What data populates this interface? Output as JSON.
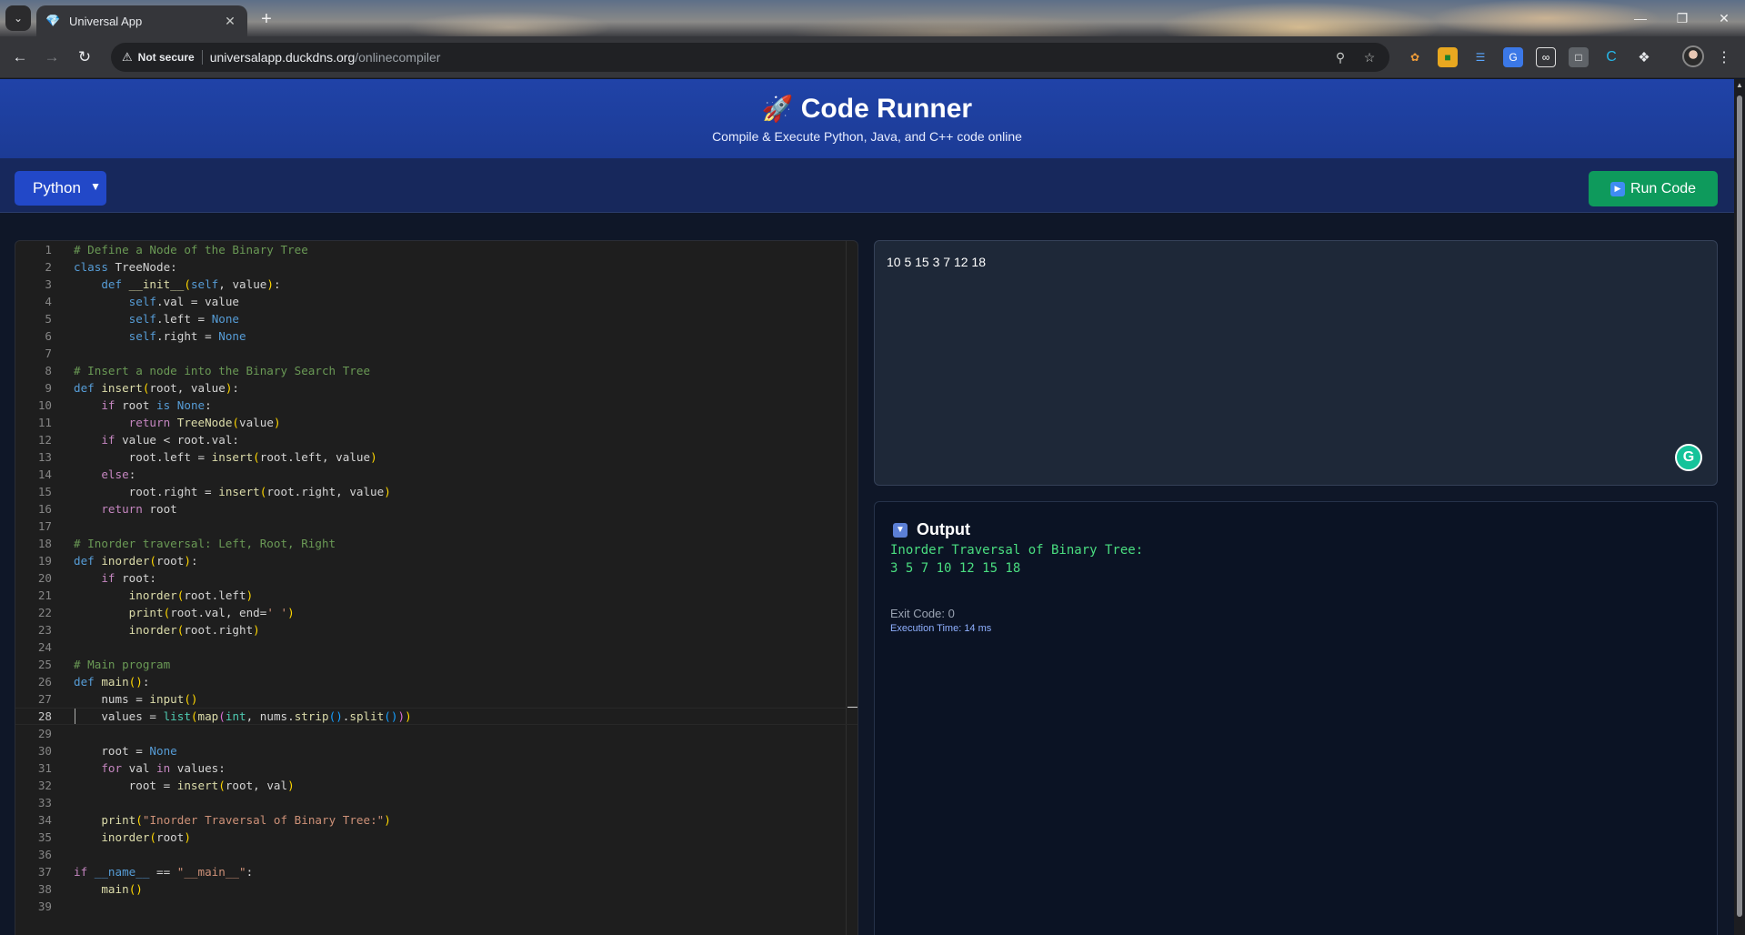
{
  "browser": {
    "tab_title": "Universal App",
    "security_label": "Not secure",
    "url_host": "universalapp.duckdns.org",
    "url_path": "/onlinecompiler"
  },
  "header": {
    "title": "Code Runner",
    "subtitle": "Compile & Execute Python, Java, and C++ code online"
  },
  "controls": {
    "language": "Python",
    "run_label": "Run Code"
  },
  "editor": {
    "active_line": 28,
    "lines": [
      [
        [
          "c-cm",
          "# Define a Node of the Binary Tree"
        ]
      ],
      [
        [
          "c-kw",
          "class"
        ],
        [
          "",
          " TreeNode:"
        ]
      ],
      [
        [
          "",
          "    "
        ],
        [
          "c-kw",
          "def"
        ],
        [
          "c-fn",
          " __init__"
        ],
        [
          "c-p1",
          "("
        ],
        [
          "c-kw",
          "self"
        ],
        [
          "",
          ", value"
        ],
        [
          "c-p1",
          ")"
        ],
        [
          "",
          ":"
        ]
      ],
      [
        [
          "",
          "        "
        ],
        [
          "c-kw",
          "self"
        ],
        [
          "",
          ".val = value"
        ]
      ],
      [
        [
          "",
          "        "
        ],
        [
          "c-kw",
          "self"
        ],
        [
          "",
          ".left = "
        ],
        [
          "c-kw",
          "None"
        ]
      ],
      [
        [
          "",
          "        "
        ],
        [
          "c-kw",
          "self"
        ],
        [
          "",
          ".right = "
        ],
        [
          "c-kw",
          "None"
        ]
      ],
      [],
      [
        [
          "c-cm",
          "# Insert a node into the Binary Search Tree"
        ]
      ],
      [
        [
          "c-kw",
          "def"
        ],
        [
          "c-fn",
          " insert"
        ],
        [
          "c-p1",
          "("
        ],
        [
          "",
          "root, value"
        ],
        [
          "c-p1",
          ")"
        ],
        [
          "",
          ":"
        ]
      ],
      [
        [
          "",
          "    "
        ],
        [
          "c-kc",
          "if"
        ],
        [
          "",
          " root "
        ],
        [
          "c-kw",
          "is"
        ],
        [
          "",
          " "
        ],
        [
          "c-kw",
          "None"
        ],
        [
          "",
          ":"
        ]
      ],
      [
        [
          "",
          "        "
        ],
        [
          "c-kc",
          "return"
        ],
        [
          "c-fn",
          " TreeNode"
        ],
        [
          "c-p1",
          "("
        ],
        [
          "",
          "value"
        ],
        [
          "c-p1",
          ")"
        ]
      ],
      [
        [
          "",
          "    "
        ],
        [
          "c-kc",
          "if"
        ],
        [
          "",
          " value < root.val:"
        ]
      ],
      [
        [
          "",
          "        root.left = "
        ],
        [
          "c-fn",
          "insert"
        ],
        [
          "c-p1",
          "("
        ],
        [
          "",
          "root.left, value"
        ],
        [
          "c-p1",
          ")"
        ]
      ],
      [
        [
          "",
          "    "
        ],
        [
          "c-kc",
          "else"
        ],
        [
          "",
          ":"
        ]
      ],
      [
        [
          "",
          "        root.right = "
        ],
        [
          "c-fn",
          "insert"
        ],
        [
          "c-p1",
          "("
        ],
        [
          "",
          "root.right, value"
        ],
        [
          "c-p1",
          ")"
        ]
      ],
      [
        [
          "",
          "    "
        ],
        [
          "c-kc",
          "return"
        ],
        [
          "",
          " root"
        ]
      ],
      [],
      [
        [
          "c-cm",
          "# Inorder traversal: Left, Root, Right"
        ]
      ],
      [
        [
          "c-kw",
          "def"
        ],
        [
          "c-fn",
          " inorder"
        ],
        [
          "c-p1",
          "("
        ],
        [
          "",
          "root"
        ],
        [
          "c-p1",
          ")"
        ],
        [
          "",
          ":"
        ]
      ],
      [
        [
          "",
          "    "
        ],
        [
          "c-kc",
          "if"
        ],
        [
          "",
          " root:"
        ]
      ],
      [
        [
          "",
          "        "
        ],
        [
          "c-fn",
          "inorder"
        ],
        [
          "c-p1",
          "("
        ],
        [
          "",
          "root.left"
        ],
        [
          "c-p1",
          ")"
        ]
      ],
      [
        [
          "",
          "        "
        ],
        [
          "c-fn",
          "print"
        ],
        [
          "c-p1",
          "("
        ],
        [
          "",
          "root.val, end="
        ],
        [
          "c-st",
          "' '"
        ],
        [
          "c-p1",
          ")"
        ]
      ],
      [
        [
          "",
          "        "
        ],
        [
          "c-fn",
          "inorder"
        ],
        [
          "c-p1",
          "("
        ],
        [
          "",
          "root.right"
        ],
        [
          "c-p1",
          ")"
        ]
      ],
      [],
      [
        [
          "c-cm",
          "# Main program"
        ]
      ],
      [
        [
          "c-kw",
          "def"
        ],
        [
          "c-fn",
          " main"
        ],
        [
          "c-p1",
          "()"
        ],
        [
          "",
          ":"
        ]
      ],
      [
        [
          "",
          "    nums = "
        ],
        [
          "c-fn",
          "input"
        ],
        [
          "c-p1",
          "()"
        ]
      ],
      [
        [
          "",
          "    values = "
        ],
        [
          "c-bi",
          "list"
        ],
        [
          "c-p1",
          "("
        ],
        [
          "c-fn",
          "map"
        ],
        [
          "c-p2",
          "("
        ],
        [
          "c-bi",
          "int"
        ],
        [
          "",
          ", nums."
        ],
        [
          "c-fn",
          "strip"
        ],
        [
          "c-p3",
          "()"
        ],
        [
          "",
          "."
        ],
        [
          "c-fn",
          "split"
        ],
        [
          "c-p3",
          "()"
        ],
        [
          "c-p2",
          ")"
        ],
        [
          "c-p1",
          ")"
        ]
      ],
      [],
      [
        [
          "",
          "    root = "
        ],
        [
          "c-kw",
          "None"
        ]
      ],
      [
        [
          "",
          "    "
        ],
        [
          "c-kc",
          "for"
        ],
        [
          "",
          " val "
        ],
        [
          "c-kc",
          "in"
        ],
        [
          "",
          " values:"
        ]
      ],
      [
        [
          "",
          "        root = "
        ],
        [
          "c-fn",
          "insert"
        ],
        [
          "c-p1",
          "("
        ],
        [
          "",
          "root, val"
        ],
        [
          "c-p1",
          ")"
        ]
      ],
      [],
      [
        [
          "",
          "    "
        ],
        [
          "c-fn",
          "print"
        ],
        [
          "c-p1",
          "("
        ],
        [
          "c-st",
          "\"Inorder Traversal of Binary Tree:\""
        ],
        [
          "c-p1",
          ")"
        ]
      ],
      [
        [
          "",
          "    "
        ],
        [
          "c-fn",
          "inorder"
        ],
        [
          "c-p1",
          "("
        ],
        [
          "",
          "root"
        ],
        [
          "c-p1",
          ")"
        ]
      ],
      [],
      [
        [
          "c-kc",
          "if"
        ],
        [
          "c-kw",
          " __name__"
        ],
        [
          "",
          " == "
        ],
        [
          "c-st",
          "\"__main__\""
        ],
        [
          "",
          ":"
        ]
      ],
      [
        [
          "",
          "    "
        ],
        [
          "c-fn",
          "main"
        ],
        [
          "c-p1",
          "()"
        ]
      ],
      []
    ]
  },
  "stdin": {
    "value": "10 5 15 3 7 12 18"
  },
  "output": {
    "title": "Output",
    "lines": [
      "Inorder Traversal of Binary Tree:",
      "3 5 7 10 12 15 18"
    ],
    "exit_code": "Exit Code: 0",
    "execution_time": "Execution Time: 14 ms"
  },
  "colors": {
    "header_bg": "#1c3b95",
    "run_button": "#0e9a5c",
    "output_text": "#4ade80",
    "select_bg": "#2248c8"
  },
  "icons": {
    "app_logo": "rocket-icon",
    "run": "play-icon",
    "output": "inbox-tray-icon",
    "grammarly": "grammarly-icon"
  }
}
